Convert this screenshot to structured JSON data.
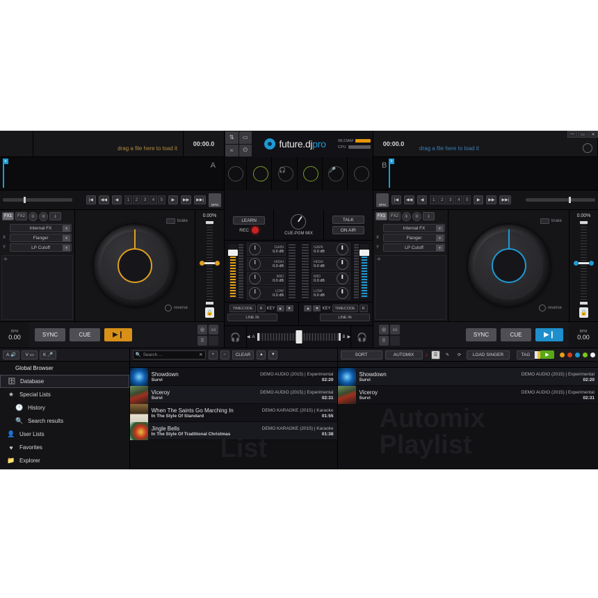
{
  "app": {
    "name": "future.dj",
    "name_suffix": "pro",
    "clock": "08:23AM",
    "cpu_label": "CPU"
  },
  "window": {
    "minimize": "—",
    "maximize": "▭",
    "close": "✕"
  },
  "decks": {
    "left": {
      "id": "A",
      "drag_hint": "drag a file here to load it",
      "time": "00:00.0",
      "hotcues": [
        "1",
        "2",
        "3",
        "4",
        "5"
      ],
      "bpm_label": "BPM",
      "bpm_value": "0.00",
      "pitch": "0.00%",
      "brake": "brake",
      "reverse": "reverse",
      "sync": "SYNC",
      "cue": "CUE",
      "play": "▶❙",
      "bpm_tap": "BPM",
      "fx": {
        "tabs": [
          "FX1",
          "FX2",
          "①",
          "②"
        ],
        "engine": "Internal FX",
        "x_label": "X",
        "y_label": "Y",
        "x_effect": "Flanger",
        "y_effect": "LP Cutoff"
      }
    },
    "right": {
      "id": "B",
      "drag_hint": "drag a file here to load it",
      "time": "00:00.0",
      "hotcues": [
        "1",
        "2",
        "3",
        "4",
        "5"
      ],
      "bpm_label": "BPM",
      "bpm_value": "0.00",
      "pitch": "0.00%",
      "brake": "brake",
      "reverse": "reverse",
      "sync": "SYNC",
      "cue": "CUE",
      "play": "▶❙",
      "bpm_tap": "BPM",
      "fx": {
        "tabs": [
          "FX1",
          "FX2",
          "①",
          "②"
        ],
        "engine": "Internal FX",
        "x_label": "X",
        "y_label": "Y",
        "x_effect": "Flanger",
        "y_effect": "LP Cutoff"
      }
    }
  },
  "mixer": {
    "learn": "LEARN",
    "rec": "REC",
    "cue_pgm_mix": "CUE-PGM MIX",
    "talk": "TALK",
    "on_air": "ON AIR",
    "eq_left": [
      {
        "name": "GAIN",
        "value": "0.0 dB"
      },
      {
        "name": "HIGH",
        "value": "0.0 dB"
      },
      {
        "name": "MID",
        "value": "0.0 dB"
      },
      {
        "name": "LOW",
        "value": "0.0 dB"
      }
    ],
    "eq_right": [
      {
        "name": "GAIN",
        "value": "0.0 dB"
      },
      {
        "name": "HIGH",
        "value": "0.0 dB"
      },
      {
        "name": "MID",
        "value": "0.0 dB"
      },
      {
        "name": "LOW",
        "value": "0.0 dB"
      }
    ],
    "timecode": "TIMECODE",
    "timecode_r": "R",
    "key": "KEY",
    "line_in": "LINE IN",
    "crossfade_a": "A",
    "crossfade_b": "B"
  },
  "browser": {
    "sidebar_title": "Global Browser",
    "items": [
      {
        "label": "Database",
        "icon": "database-icon",
        "selected": true,
        "sub": false
      },
      {
        "label": "Special Lists",
        "icon": "star-icon",
        "selected": false,
        "sub": false
      },
      {
        "label": "History",
        "icon": "clock-icon",
        "selected": false,
        "sub": true
      },
      {
        "label": "Search results",
        "icon": "search-icon",
        "selected": false,
        "sub": true
      },
      {
        "label": "User Lists",
        "icon": "user-icon",
        "selected": false,
        "sub": false
      },
      {
        "label": "Favorites",
        "icon": "heart-icon",
        "selected": false,
        "sub": false
      },
      {
        "label": "Explorer",
        "icon": "folder-icon",
        "selected": false,
        "sub": false
      }
    ],
    "toolbar_left": [
      "A",
      "V",
      "K"
    ],
    "search_placeholder": "Search ...",
    "clear": "CLEAR",
    "sort": "SORT",
    "automix": "AUTOMIX",
    "load_singer": "LOAD SINGER",
    "tag": "TAG",
    "list_watermark": "List",
    "playlist_watermark_1": "Automix",
    "playlist_watermark_2": "Playlist",
    "tracks": [
      {
        "title": "Showdown",
        "artist": "Survi",
        "album": "DEMO AUDIO (2015) | Experimental",
        "time": "02:20",
        "art": "blue"
      },
      {
        "title": "Viceroy",
        "artist": "Survi",
        "album": "DEMO AUDIO (2015) | Experimental",
        "time": "02:31",
        "art": "mush"
      },
      {
        "title": "When The Saints Go Marching In",
        "artist": "In The Style Of Standard",
        "album": "DEMO KARAOKE (2015) | Karaoke",
        "time": "01:55",
        "art": "saints"
      },
      {
        "title": "Jingle Bells",
        "artist": "In The Style Of Traditional Christmas",
        "album": "DEMO KARAOKE (2015) | Karaoke",
        "time": "01:38",
        "art": "bells"
      }
    ],
    "playlist_tracks": [
      {
        "title": "Showdown",
        "artist": "Survi",
        "album": "DEMO AUDIO (2015) | Experimental",
        "time": "02:20",
        "art": "blue"
      },
      {
        "title": "Viceroy",
        "artist": "Survi",
        "album": "DEMO AUDIO (2015) | Experimental",
        "time": "02:31",
        "art": "mush"
      }
    ]
  },
  "colors": {
    "deck_a": "#e0a020",
    "deck_b": "#1e9ad6",
    "rec": "#cc2222"
  }
}
